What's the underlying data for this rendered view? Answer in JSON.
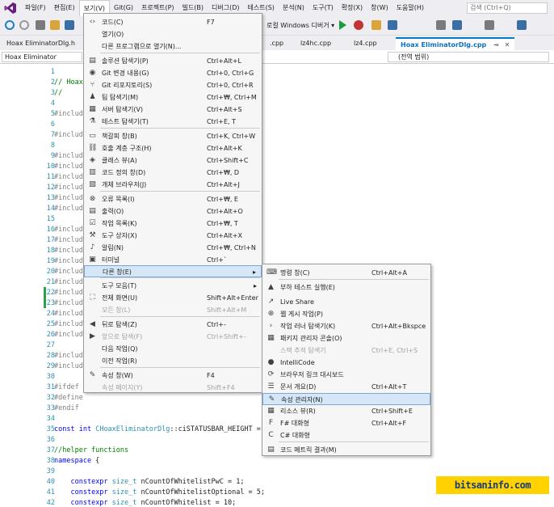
{
  "menubar": {
    "items": [
      "파일(F)",
      "편집(E)",
      "보기(V)",
      "Git(G)",
      "프로젝트(P)",
      "빌드(B)",
      "디버그(D)",
      "테스트(S)",
      "분석(N)",
      "도구(T)",
      "확장(X)",
      "창(W)",
      "도움말(H)"
    ],
    "search_placeholder": "검색 (Ctrl+Q)"
  },
  "toolbar": {
    "debugger_label": "로컬 Windows 디버거 ▾"
  },
  "tabs": [
    "Hoax EliminatorDlg.h",
    ".cpp",
    "lz4hc.cpp",
    "lz4.cpp",
    "Hoax EliminatorDlg.cpp"
  ],
  "navbar": {
    "project": "Hoax Eliminator",
    "scope": "(전역 범위)"
  },
  "editor": {
    "lines": [
      {
        "n": "1",
        "t": ""
      },
      {
        "n": "2",
        "t": "// Hoax"
      },
      {
        "n": "3",
        "t": "//"
      },
      {
        "n": "4",
        "t": ""
      },
      {
        "n": "5",
        "t": "#include"
      },
      {
        "n": "6",
        "t": ""
      },
      {
        "n": "7",
        "t": "#include"
      },
      {
        "n": "8",
        "t": ""
      },
      {
        "n": "9",
        "t": "#include"
      },
      {
        "n": "10",
        "t": "#include"
      },
      {
        "n": "11",
        "t": "#include"
      },
      {
        "n": "12",
        "t": "#include"
      },
      {
        "n": "13",
        "t": "#include"
      },
      {
        "n": "14",
        "t": "#include"
      },
      {
        "n": "15",
        "t": ""
      },
      {
        "n": "16",
        "t": "#include"
      },
      {
        "n": "17",
        "t": "#include"
      },
      {
        "n": "18",
        "t": "#include"
      },
      {
        "n": "19",
        "t": "#include"
      },
      {
        "n": "20",
        "t": "#include"
      },
      {
        "n": "21",
        "t": "#include"
      },
      {
        "n": "22",
        "t": "#include"
      },
      {
        "n": "23",
        "t": "#include"
      },
      {
        "n": "24",
        "t": "#include"
      },
      {
        "n": "25",
        "t": "#include"
      },
      {
        "n": "26",
        "t": "#include"
      },
      {
        "n": "27",
        "t": ""
      },
      {
        "n": "28",
        "t": "#include"
      },
      {
        "n": "29",
        "t": "#include"
      },
      {
        "n": "30",
        "t": ""
      },
      {
        "n": "31",
        "t": "#ifdef _"
      },
      {
        "n": "32",
        "t": "#define"
      },
      {
        "n": "33",
        "t": "#endif"
      },
      {
        "n": "34",
        "t": ""
      },
      {
        "n": "35",
        "t": "const int CHoaxEliminatorDlg::ciSTATUSBAR_HEIGHT = 16;"
      },
      {
        "n": "36",
        "t": ""
      },
      {
        "n": "37",
        "t": "//helper functions"
      },
      {
        "n": "38",
        "t": "namespace {"
      },
      {
        "n": "39",
        "t": ""
      },
      {
        "n": "40",
        "t": "    constexpr size_t nCountOfWhitelistPwC = 1;"
      },
      {
        "n": "41",
        "t": "    constexpr size_t nCountOfWhitelistOptional = 5;"
      },
      {
        "n": "42",
        "t": "    constexpr size_t nCountOfWhitelist = 10;"
      }
    ]
  },
  "view_menu": {
    "items": [
      {
        "icon": "code-icon",
        "label": "코드(C)",
        "shortcut": "F7",
        "dis": false
      },
      {
        "icon": "",
        "label": "열기(O)",
        "shortcut": "",
        "dis": false
      },
      {
        "icon": "",
        "label": "다른 프로그램으로 열기(N)...",
        "shortcut": "",
        "dis": false
      },
      {
        "icon": "solution-explorer-icon",
        "label": "솔루션 탐색기(P)",
        "shortcut": "Ctrl+Alt+L",
        "dis": false
      },
      {
        "icon": "git-changes-icon",
        "label": "Git 변경 내용(G)",
        "shortcut": "Ctrl+0, Ctrl+G",
        "dis": false
      },
      {
        "icon": "git-repo-icon",
        "label": "Git 리포지토리(S)",
        "shortcut": "Ctrl+0, Ctrl+R",
        "dis": false
      },
      {
        "icon": "team-explorer-icon",
        "label": "팀 탐색기(M)",
        "shortcut": "Ctrl+₩, Ctrl+M",
        "dis": false
      },
      {
        "icon": "server-explorer-icon",
        "label": "서버 탐색기(V)",
        "shortcut": "Ctrl+Alt+S",
        "dis": false
      },
      {
        "icon": "test-explorer-icon",
        "label": "테스트 탐색기(T)",
        "shortcut": "Ctrl+E, T",
        "dis": false
      },
      {
        "icon": "bookmark-icon",
        "label": "책갈피 창(B)",
        "shortcut": "Ctrl+K, Ctrl+W",
        "dis": false
      },
      {
        "icon": "call-hierarchy-icon",
        "label": "호출 계층 구조(H)",
        "shortcut": "Ctrl+Alt+K",
        "dis": false
      },
      {
        "icon": "class-view-icon",
        "label": "클래스 뷰(A)",
        "shortcut": "Ctrl+Shift+C",
        "dis": false
      },
      {
        "icon": "code-definition-icon",
        "label": "코드 정의 창(D)",
        "shortcut": "Ctrl+₩, D",
        "dis": false
      },
      {
        "icon": "object-browser-icon",
        "label": "개체 브라우저(J)",
        "shortcut": "Ctrl+Alt+J",
        "dis": false
      },
      {
        "icon": "error-list-icon",
        "label": "오류 목록(I)",
        "shortcut": "Ctrl+₩, E",
        "dis": false
      },
      {
        "icon": "output-icon",
        "label": "출력(O)",
        "shortcut": "Ctrl+Alt+O",
        "dis": false
      },
      {
        "icon": "task-list-icon",
        "label": "작업 목록(K)",
        "shortcut": "Ctrl+₩, T",
        "dis": false
      },
      {
        "icon": "toolbox-icon",
        "label": "도구 상자(X)",
        "shortcut": "Ctrl+Alt+X",
        "dis": false
      },
      {
        "icon": "notification-icon",
        "label": "알림(N)",
        "shortcut": "Ctrl+₩, Ctrl+N",
        "dis": false
      },
      {
        "icon": "terminal-icon",
        "label": "터미널",
        "shortcut": "Ctrl+`",
        "dis": false
      },
      {
        "icon": "",
        "label": "다른 창(E)",
        "shortcut": "",
        "dis": false,
        "sub": true
      },
      {
        "icon": "",
        "label": "도구 모음(T)",
        "shortcut": "",
        "dis": false,
        "sub": true
      },
      {
        "icon": "fullscreen-icon",
        "label": "전체 화면(U)",
        "shortcut": "Shift+Alt+Enter",
        "dis": false
      },
      {
        "icon": "",
        "label": "모든 창(L)",
        "shortcut": "Shift+Alt+M",
        "dis": true
      },
      {
        "icon": "back-icon",
        "label": "뒤로 탐색(Z)",
        "shortcut": "Ctrl+-",
        "dis": false
      },
      {
        "icon": "forward-icon",
        "label": "앞으로 탐색(F)",
        "shortcut": "Ctrl+Shift+-",
        "dis": true
      },
      {
        "icon": "",
        "label": "다음 작업(Q)",
        "shortcut": "",
        "dis": false
      },
      {
        "icon": "",
        "label": "이전 작업(R)",
        "shortcut": "",
        "dis": false
      },
      {
        "icon": "properties-icon",
        "label": "속성 창(W)",
        "shortcut": "F4",
        "dis": false
      },
      {
        "icon": "",
        "label": "속성 페이지(Y)",
        "shortcut": "Shift+F4",
        "dis": true
      }
    ]
  },
  "other_windows_menu": {
    "items": [
      {
        "icon": "command-window-icon",
        "label": "명령 창(C)",
        "shortcut": "Ctrl+Alt+A",
        "dis": false
      },
      {
        "icon": "load-test-icon",
        "label": "부하 테스트 실행(E)",
        "shortcut": "",
        "dis": false
      },
      {
        "icon": "live-share-icon",
        "label": "Live Share",
        "shortcut": "",
        "dis": false
      },
      {
        "icon": "web-publish-icon",
        "label": "웹 게시 작업(P)",
        "shortcut": "",
        "dis": false
      },
      {
        "icon": "task-runner-icon",
        "label": "작업 러너 탐색기(K)",
        "shortcut": "Ctrl+Alt+Bkspce",
        "dis": false
      },
      {
        "icon": "package-console-icon",
        "label": "패키지 관리자 콘솔(O)",
        "shortcut": "",
        "dis": false
      },
      {
        "icon": "",
        "label": "스택 추적 탐색기",
        "shortcut": "Ctrl+E, Ctrl+S",
        "dis": true
      },
      {
        "icon": "intellicode-icon",
        "label": "IntelliCode",
        "shortcut": "",
        "dis": false
      },
      {
        "icon": "browser-link-icon",
        "label": "브라우저 링크 대시보드",
        "shortcut": "",
        "dis": false
      },
      {
        "icon": "document-outline-icon",
        "label": "문서 개요(D)",
        "shortcut": "Ctrl+Alt+T",
        "dis": false
      },
      {
        "icon": "property-manager-icon",
        "label": "속성 관리자(N)",
        "shortcut": "",
        "dis": false,
        "hl": true
      },
      {
        "icon": "resource-view-icon",
        "label": "리소스 뷰(R)",
        "shortcut": "Ctrl+Shift+E",
        "dis": false
      },
      {
        "icon": "fsharp-icon",
        "label": "F# 대화형",
        "shortcut": "Ctrl+Alt+F",
        "dis": false
      },
      {
        "icon": "csharp-icon",
        "label": "C# 대화형",
        "shortcut": "",
        "dis": false
      },
      {
        "icon": "code-metrics-icon",
        "label": "코드 메트릭 결과(M)",
        "shortcut": "",
        "dis": false
      }
    ]
  },
  "watermark": "bitsaninfo.com"
}
